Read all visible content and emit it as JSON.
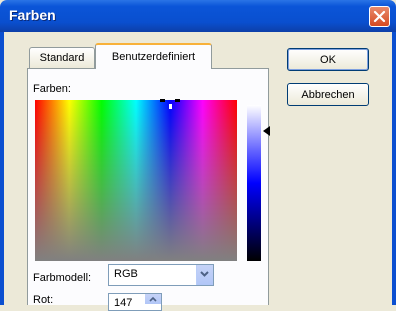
{
  "window": {
    "title": "Farben"
  },
  "tabs": [
    {
      "label": "Standard",
      "selected": false
    },
    {
      "label": "Benutzerdefiniert",
      "selected": true
    }
  ],
  "colors_label": "Farben:",
  "color_model": {
    "label": "Farbmodell:",
    "value": "RGB"
  },
  "red": {
    "label": "Rot:",
    "value": "147"
  },
  "buttons": {
    "ok": "OK",
    "cancel": "Abbrechen"
  },
  "accent_colors": {
    "titlebar": "#0b55d8",
    "close": "#d64a20",
    "tab_highlight": "#f8b13a"
  }
}
